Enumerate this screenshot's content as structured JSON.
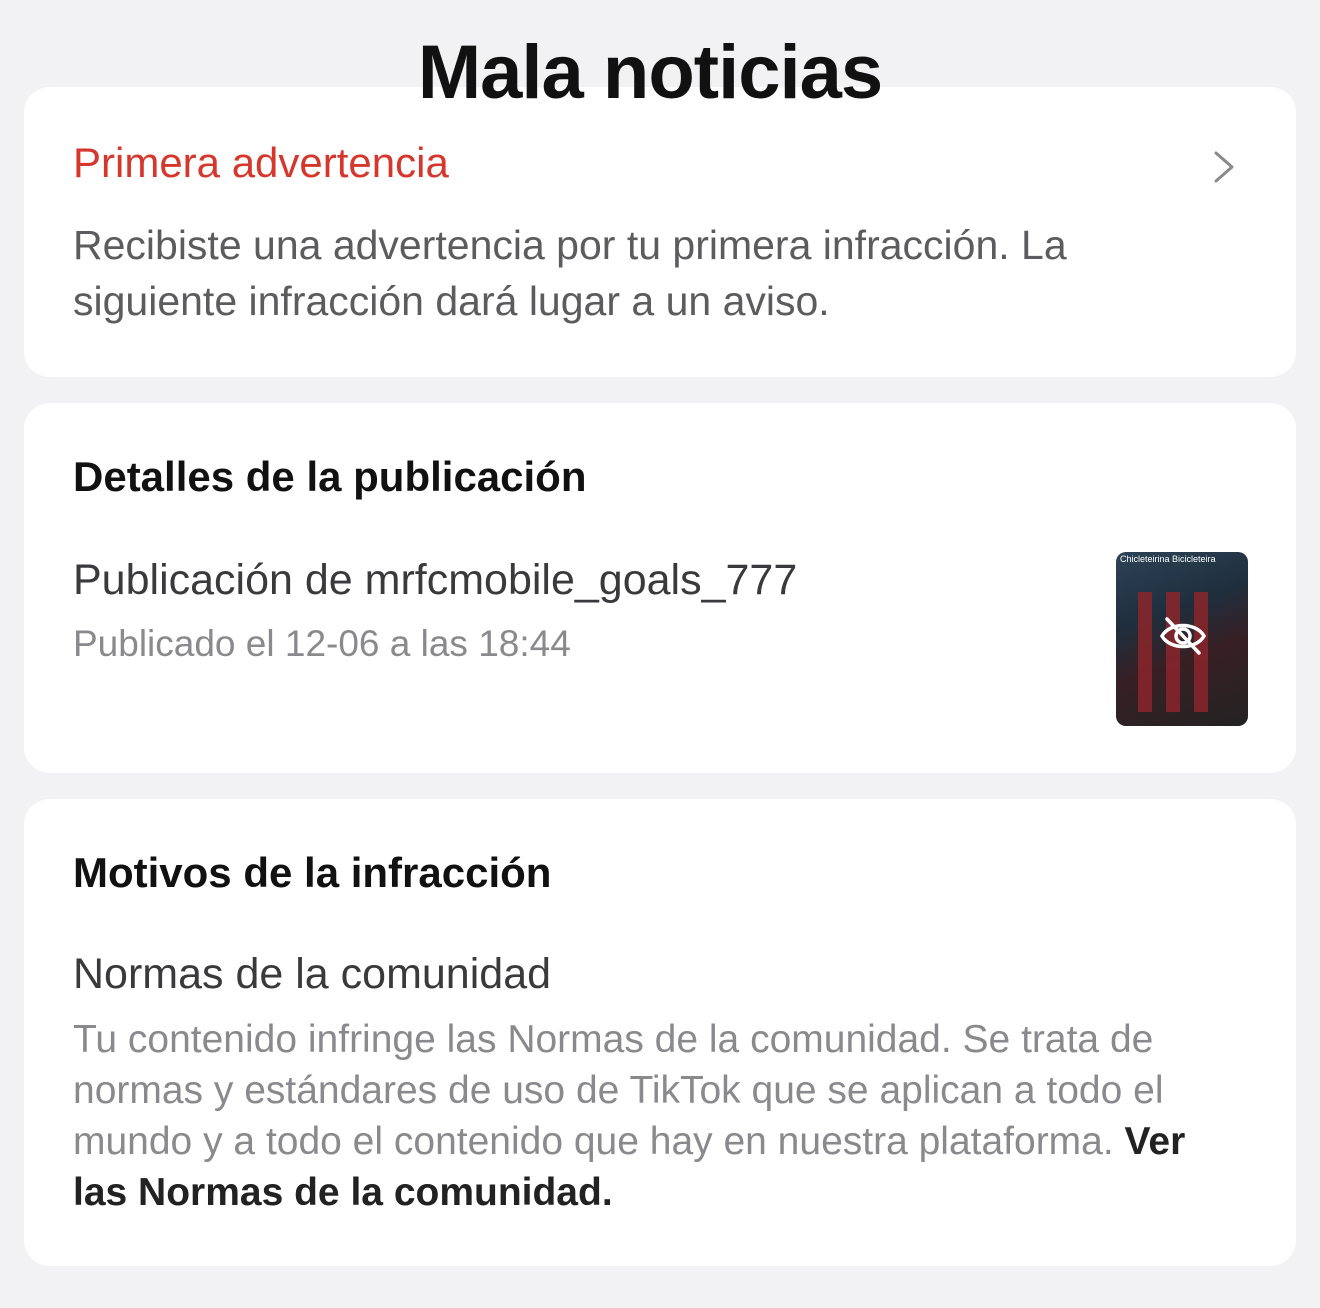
{
  "overlay_title": "Mala noticias",
  "warning_card": {
    "title": "Primera advertencia",
    "description": "Recibiste una advertencia por tu primera infracción. La siguiente infracción dará lugar a un aviso.",
    "icon": "chevron-right-icon"
  },
  "details_card": {
    "heading": "Detalles de la publicación",
    "post_title": "Publicación de mrfcmobile_goals_777",
    "post_date": "Publicado el 12-06 a las 18:44",
    "thumbnail": {
      "caption": "Chicleteirina Bicicleteira",
      "icon": "eye-off-icon"
    }
  },
  "reasons_card": {
    "heading": "Motivos de la infracción",
    "rule_title": "Normas de la comunidad",
    "rule_text": "Tu contenido infringe las Normas de la comunidad. Se trata de normas y estándares de uso de TikTok que se aplican a todo el mundo y a todo el contenido que hay en nuestra plataforma. ",
    "rule_link": "Ver las Normas de la comunidad."
  },
  "colors": {
    "warning_red": "#d6372c",
    "background": "#f2f2f4",
    "card": "#ffffff"
  }
}
